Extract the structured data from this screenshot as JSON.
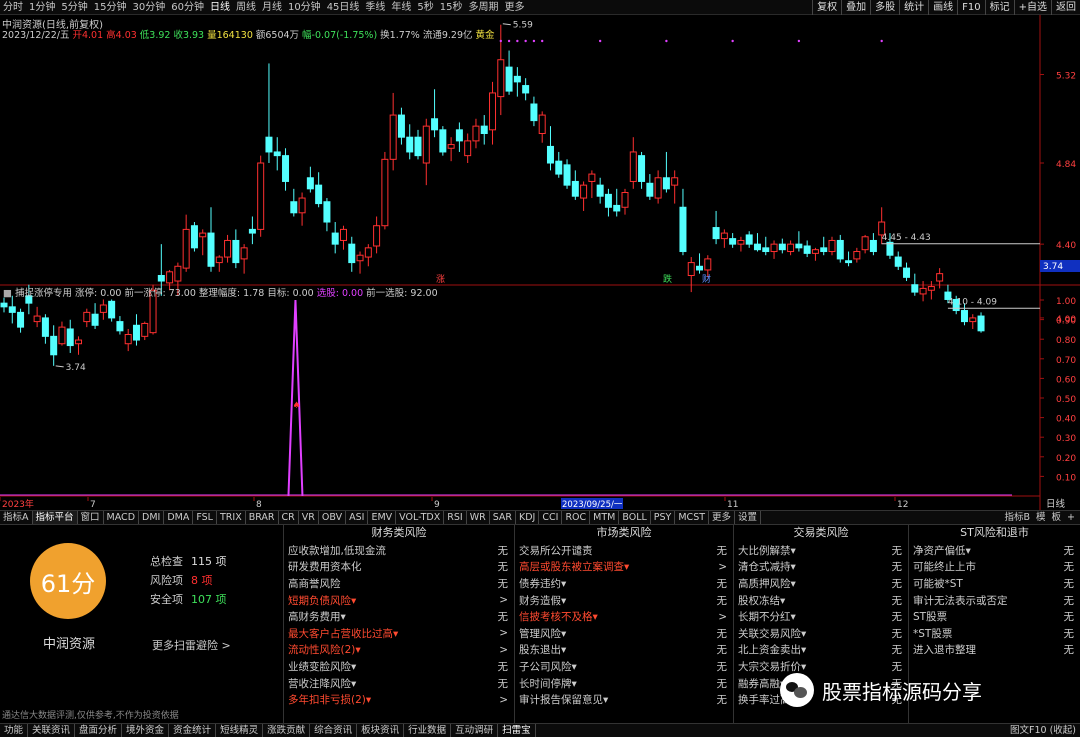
{
  "topbar": {
    "periods": [
      "分时",
      "1分钟",
      "5分钟",
      "15分钟",
      "30分钟",
      "60分钟",
      "日线",
      "周线",
      "月线",
      "10分钟",
      "45日线",
      "季线",
      "年线",
      "5秒",
      "15秒",
      "多周期",
      "更多"
    ],
    "active_period": "日线",
    "tools": [
      "复权",
      "叠加",
      "多股",
      "统计",
      "画线",
      "F10",
      "标记",
      "+自选",
      "返回"
    ]
  },
  "header": {
    "title": "中润资源(日线,前复权)",
    "date": "2023/12/22/五",
    "open": "开4.01",
    "high": "高4.03",
    "low": "低3.92",
    "close": "收3.93",
    "volume": "量164130",
    "amount": "额6504万",
    "change": "幅-0.07(-1.75%)",
    "turnover": "换1.77%",
    "float": "流通9.29亿",
    "tag": "黄金"
  },
  "price_axis": {
    "labels": [
      "5.32",
      "4.84",
      "4.40",
      "4.00"
    ],
    "current_price": "3.74"
  },
  "annotations": {
    "high_mark": "5.59",
    "low_mark": "3.74",
    "range1": "4.45 - 4.43",
    "range2": "4.10 - 4.09",
    "event_rise": "涨",
    "event_fall": "跌",
    "event_fin": "财"
  },
  "indicator": {
    "name": "捕捉涨停专用",
    "zt_label": "涨停:",
    "zt_value": "0.00",
    "prev_zt_label": "前一涨停:",
    "prev_zt_value": "73.00",
    "range_label": "整理幅度:",
    "range_value": "1.78",
    "target_label": "目标:",
    "target_value": "0.00",
    "pick_label": "选股:",
    "pick_value": "0.00",
    "prev_pick_label": "前一选股:",
    "prev_pick_value": "92.00",
    "axis_labels": [
      "1.00",
      "0.90",
      "0.80",
      "0.70",
      "0.60",
      "0.50",
      "0.40",
      "0.30",
      "0.20",
      "0.10"
    ]
  },
  "time_axis": {
    "labels": [
      "2023年",
      "7",
      "8",
      "9",
      "2023/09/25/一",
      "11",
      "12"
    ],
    "right_label": "日线"
  },
  "indicator_tabs": {
    "items": [
      "指标A",
      "指标平台",
      "窗口",
      "MACD",
      "DMI",
      "DMA",
      "FSL",
      "TRIX",
      "BRAR",
      "CR",
      "VR",
      "OBV",
      "ASI",
      "EMV",
      "VOL-TDX",
      "RSI",
      "WR",
      "SAR",
      "KDJ",
      "CCI",
      "ROC",
      "MTM",
      "BOLL",
      "PSY",
      "MCST",
      "更多",
      "设置"
    ],
    "active": "指标平台",
    "right": [
      "指标B",
      "模",
      "板",
      "+"
    ]
  },
  "score": {
    "value": "61分",
    "stock_name": "中润资源",
    "total_label": "总检查",
    "total_value": "115 项",
    "risk_label": "风险项",
    "risk_value": "8 项",
    "safe_label": "安全项",
    "safe_value": "107 项",
    "more_scan": "更多扫雷避险 >",
    "disclaimer": "通达信大数据评测,仅供参考,不作为投资依据"
  },
  "categories": [
    {
      "title": "财务类风险",
      "items": [
        {
          "label": "应收款增加,低现金流",
          "status": "无",
          "red": false
        },
        {
          "label": "研发费用资本化",
          "status": "无",
          "red": false
        },
        {
          "label": "高商誉风险",
          "status": "无",
          "red": false
        },
        {
          "label": "短期负债风险▾",
          "status": ">",
          "red": true
        },
        {
          "label": "高财务费用▾",
          "status": "无",
          "red": false
        },
        {
          "label": "最大客户占营收比过高▾",
          "status": ">",
          "red": true
        },
        {
          "label": "流动性风险(2)▾",
          "status": ">",
          "red": true
        },
        {
          "label": "业绩变脸风险▾",
          "status": "无",
          "red": false
        },
        {
          "label": "营收注降风险▾",
          "status": "无",
          "red": false
        },
        {
          "label": "多年扣非亏损(2)▾",
          "status": ">",
          "red": true
        }
      ]
    },
    {
      "title": "市场类风险",
      "items": [
        {
          "label": "交易所公开谴责",
          "status": "无",
          "red": false
        },
        {
          "label": "高层或股东被立案调查▾",
          "status": ">",
          "red": true
        },
        {
          "label": "债券违约▾",
          "status": "无",
          "red": false
        },
        {
          "label": "财务造假▾",
          "status": "无",
          "red": false
        },
        {
          "label": "信披考核不及格▾",
          "status": ">",
          "red": true
        },
        {
          "label": "管理风险▾",
          "status": "无",
          "red": false
        },
        {
          "label": "股东退出▾",
          "status": "无",
          "red": false
        },
        {
          "label": "子公司风险▾",
          "status": "无",
          "red": false
        },
        {
          "label": "长时间停牌▾",
          "status": "无",
          "red": false
        },
        {
          "label": "审计报告保留意见▾",
          "status": "无",
          "red": false
        }
      ]
    },
    {
      "title": "交易类风险",
      "items": [
        {
          "label": "大比例解禁▾",
          "status": "无",
          "red": false
        },
        {
          "label": "清仓式减持▾",
          "status": "无",
          "red": false
        },
        {
          "label": "高质押风险▾",
          "status": "无",
          "red": false
        },
        {
          "label": "股权冻结▾",
          "status": "无",
          "red": false
        },
        {
          "label": "长期不分红▾",
          "status": "无",
          "red": false
        },
        {
          "label": "关联交易风险▾",
          "status": "无",
          "red": false
        },
        {
          "label": "北上资金卖出▾",
          "status": "无",
          "red": false
        },
        {
          "label": "大宗交易折价▾",
          "status": "无",
          "red": false
        },
        {
          "label": "融券高融▾",
          "status": "无",
          "red": false
        },
        {
          "label": "换手率过高▾",
          "status": "无",
          "red": false
        }
      ]
    },
    {
      "title": "ST风险和退市",
      "items": [
        {
          "label": "净资产偏低▾",
          "status": "无",
          "red": false
        },
        {
          "label": "可能终止上市",
          "status": "无",
          "red": false
        },
        {
          "label": "可能被*ST",
          "status": "无",
          "red": false
        },
        {
          "label": "审计无法表示或否定",
          "status": "无",
          "red": false
        },
        {
          "label": "ST股票",
          "status": "无",
          "red": false
        },
        {
          "label": "*ST股票",
          "status": "无",
          "red": false
        },
        {
          "label": "进入退市整理",
          "status": "无",
          "red": false
        }
      ]
    }
  ],
  "watermark": "股票指标源码分享",
  "bottombar": {
    "items": [
      "功能",
      "关联资讯",
      "盘面分析",
      "境外资金",
      "资金统计",
      "短线精灵",
      "涨跌贡献",
      "综合资讯",
      "板块资讯",
      "行业数据",
      "互动调研",
      "扫雷宝"
    ],
    "active": "扫雷宝",
    "right": "图文F10 (收起)"
  },
  "colors": {
    "up": "#ff3030",
    "down": "#54ffff",
    "indicator": "#e040ff",
    "score": "#f0a12e"
  },
  "candles": [
    [
      4.08,
      4.11,
      4.03,
      4.06
    ],
    [
      4.06,
      4.12,
      3.97,
      4.03
    ],
    [
      4.03,
      4.05,
      3.92,
      3.95
    ],
    [
      4.12,
      4.18,
      4.02,
      4.08
    ],
    [
      3.98,
      4.06,
      3.95,
      4.01
    ],
    [
      4.0,
      4.02,
      3.86,
      3.9
    ],
    [
      3.9,
      3.96,
      3.74,
      3.8
    ],
    [
      3.86,
      3.98,
      3.85,
      3.95
    ],
    [
      3.94,
      3.99,
      3.81,
      3.85
    ],
    [
      3.86,
      3.9,
      3.8,
      3.88
    ],
    [
      3.98,
      4.05,
      3.95,
      4.03
    ],
    [
      4.02,
      4.08,
      3.94,
      3.96
    ],
    [
      4.03,
      4.1,
      3.99,
      4.07
    ],
    [
      4.09,
      4.1,
      3.98,
      4.0
    ],
    [
      3.98,
      4.01,
      3.91,
      3.93
    ],
    [
      3.86,
      3.94,
      3.82,
      3.91
    ],
    [
      3.96,
      4.02,
      3.85,
      3.88
    ],
    [
      3.9,
      3.98,
      3.88,
      3.97
    ],
    [
      3.92,
      4.18,
      3.91,
      4.15
    ],
    [
      4.23,
      4.4,
      4.12,
      4.2
    ],
    [
      4.19,
      4.26,
      4.15,
      4.25
    ],
    [
      4.2,
      4.3,
      4.12,
      4.28
    ],
    [
      4.27,
      4.56,
      4.25,
      4.48
    ],
    [
      4.5,
      4.52,
      4.36,
      4.38
    ],
    [
      4.44,
      4.48,
      4.34,
      4.46
    ],
    [
      4.46,
      4.6,
      4.25,
      4.28
    ],
    [
      4.3,
      4.34,
      4.25,
      4.33
    ],
    [
      4.33,
      4.45,
      4.3,
      4.42
    ],
    [
      4.42,
      4.48,
      4.27,
      4.3
    ],
    [
      4.32,
      4.4,
      4.24,
      4.38
    ],
    [
      4.48,
      4.55,
      4.4,
      4.46
    ],
    [
      4.48,
      4.88,
      4.44,
      4.84
    ],
    [
      4.98,
      5.38,
      4.84,
      4.9
    ],
    [
      4.9,
      4.98,
      4.8,
      4.88
    ],
    [
      4.88,
      4.92,
      4.69,
      4.74
    ],
    [
      4.63,
      4.7,
      4.55,
      4.57
    ],
    [
      4.57,
      4.68,
      4.5,
      4.65
    ],
    [
      4.76,
      4.82,
      4.68,
      4.7
    ],
    [
      4.72,
      4.79,
      4.6,
      4.62
    ],
    [
      4.63,
      4.65,
      4.47,
      4.52
    ],
    [
      4.46,
      4.52,
      4.35,
      4.4
    ],
    [
      4.42,
      4.5,
      4.37,
      4.48
    ],
    [
      4.4,
      4.44,
      4.25,
      4.3
    ],
    [
      4.31,
      4.36,
      4.24,
      4.34
    ],
    [
      4.33,
      4.4,
      4.28,
      4.38
    ],
    [
      4.39,
      4.55,
      4.35,
      4.5
    ],
    [
      4.5,
      4.9,
      4.48,
      4.86
    ],
    [
      4.86,
      5.22,
      4.8,
      5.1
    ],
    [
      5.1,
      5.14,
      4.94,
      4.98
    ],
    [
      4.98,
      5.05,
      4.86,
      4.9
    ],
    [
      4.98,
      5.02,
      4.86,
      4.88
    ],
    [
      4.84,
      5.08,
      4.72,
      5.04
    ],
    [
      5.08,
      5.24,
      4.98,
      5.02
    ],
    [
      5.02,
      5.04,
      4.88,
      4.9
    ],
    [
      4.92,
      4.98,
      4.85,
      4.94
    ],
    [
      5.02,
      5.06,
      4.9,
      4.96
    ],
    [
      4.88,
      5.0,
      4.84,
      4.96
    ],
    [
      4.96,
      5.08,
      4.92,
      5.04
    ],
    [
      5.04,
      5.1,
      4.94,
      5.0
    ],
    [
      5.02,
      5.28,
      4.94,
      5.22
    ],
    [
      5.2,
      5.59,
      5.1,
      5.4
    ],
    [
      5.36,
      5.45,
      5.21,
      5.23
    ],
    [
      5.31,
      5.36,
      5.2,
      5.28
    ],
    [
      5.26,
      5.3,
      5.18,
      5.22
    ],
    [
      5.16,
      5.2,
      5.04,
      5.07
    ],
    [
      5.0,
      5.12,
      4.95,
      5.1
    ],
    [
      4.93,
      5.04,
      4.8,
      4.84
    ],
    [
      4.85,
      4.9,
      4.76,
      4.78
    ],
    [
      4.83,
      4.86,
      4.7,
      4.72
    ],
    [
      4.74,
      4.8,
      4.64,
      4.66
    ],
    [
      4.65,
      4.74,
      4.58,
      4.72
    ],
    [
      4.74,
      4.8,
      4.65,
      4.78
    ],
    [
      4.72,
      4.76,
      4.62,
      4.66
    ],
    [
      4.67,
      4.7,
      4.55,
      4.6
    ],
    [
      4.61,
      4.7,
      4.55,
      4.58
    ],
    [
      4.6,
      4.7,
      4.56,
      4.68
    ],
    [
      4.74,
      4.98,
      4.7,
      4.9
    ],
    [
      4.88,
      4.9,
      4.7,
      4.74
    ],
    [
      4.73,
      4.78,
      4.64,
      4.66
    ],
    [
      4.65,
      4.8,
      4.62,
      4.76
    ],
    [
      4.76,
      4.9,
      4.68,
      4.7
    ],
    [
      4.72,
      4.8,
      4.62,
      4.76
    ],
    [
      4.6,
      4.7,
      4.34,
      4.36
    ],
    [
      4.23,
      4.33,
      4.14,
      4.3
    ],
    [
      4.28,
      4.35,
      4.24,
      4.26
    ],
    [
      4.26,
      4.34,
      4.22,
      4.32
    ],
    [
      4.49,
      4.58,
      4.4,
      4.43
    ],
    [
      4.43,
      4.48,
      4.38,
      4.46
    ],
    [
      4.43,
      4.46,
      4.38,
      4.4
    ],
    [
      4.4,
      4.44,
      4.36,
      4.42
    ],
    [
      4.45,
      4.47,
      4.38,
      4.4
    ],
    [
      4.4,
      4.46,
      4.36,
      4.37
    ],
    [
      4.38,
      4.44,
      4.34,
      4.36
    ],
    [
      4.36,
      4.42,
      4.32,
      4.4
    ],
    [
      4.4,
      4.43,
      4.35,
      4.37
    ],
    [
      4.36,
      4.42,
      4.34,
      4.4
    ],
    [
      4.4,
      4.47,
      4.36,
      4.38
    ],
    [
      4.39,
      4.42,
      4.33,
      4.35
    ],
    [
      4.35,
      4.38,
      4.31,
      4.37
    ],
    [
      4.38,
      4.44,
      4.34,
      4.36
    ],
    [
      4.36,
      4.44,
      4.34,
      4.42
    ],
    [
      4.42,
      4.45,
      4.3,
      4.32
    ],
    [
      4.31,
      4.36,
      4.28,
      4.3
    ],
    [
      4.32,
      4.38,
      4.3,
      4.36
    ],
    [
      4.37,
      4.45,
      4.35,
      4.44
    ],
    [
      4.42,
      4.46,
      4.34,
      4.36
    ],
    [
      4.45,
      4.6,
      4.4,
      4.52
    ],
    [
      4.41,
      4.46,
      4.32,
      4.34
    ],
    [
      4.33,
      4.36,
      4.26,
      4.28
    ],
    [
      4.27,
      4.3,
      4.2,
      4.22
    ],
    [
      4.18,
      4.24,
      4.12,
      4.14
    ],
    [
      4.13,
      4.2,
      4.09,
      4.16
    ],
    [
      4.15,
      4.2,
      4.1,
      4.17
    ],
    [
      4.2,
      4.27,
      4.16,
      4.24
    ],
    [
      4.14,
      4.18,
      4.08,
      4.1
    ],
    [
      4.1,
      4.12,
      4.02,
      4.04
    ],
    [
      4.04,
      4.08,
      3.96,
      3.98
    ],
    [
      3.98,
      4.02,
      3.94,
      4.0
    ],
    [
      4.01,
      4.03,
      3.92,
      3.93
    ]
  ]
}
